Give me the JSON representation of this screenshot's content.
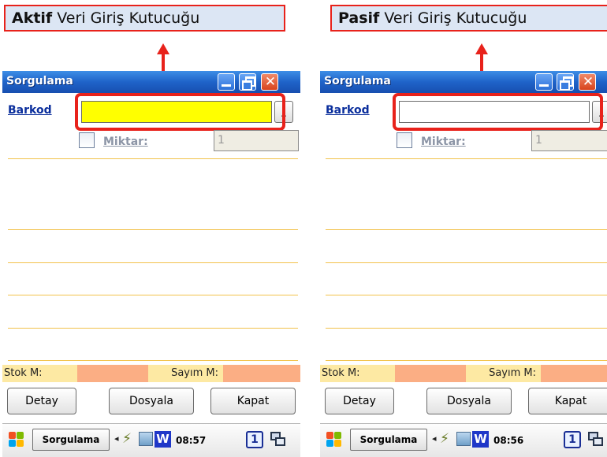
{
  "callouts": {
    "left_bold": "Aktif",
    "left_rest": " Veri Giriş Kutucuğu",
    "right_bold": "Pasif",
    "right_rest": " Veri Giriş Kutucuğu"
  },
  "colors": {
    "highlight": "#e8221b",
    "active_input_bg": "#ffff00",
    "passive_input_bg": "#ffffff",
    "row_line": "#f2c24b",
    "stok_label_bg": "#fde9a3",
    "stok_value_bg": "#fbae84",
    "titlebar": "#1f63c9"
  },
  "devices": [
    {
      "title": "Sorgulama",
      "barkod_label": "Barkod",
      "barkod_value": "",
      "browse_label": "..",
      "miktar_label": "Miktar:",
      "miktar_value": "1",
      "stok_label": "Stok M:",
      "sayim_label": "Sayım M:",
      "buttons": [
        "Detay",
        "Dosyala",
        "Kapat"
      ],
      "taskbar_title": "Sorgulama",
      "clock": "08:57",
      "page_number": "1"
    },
    {
      "title": "Sorgulama",
      "barkod_label": "Barkod",
      "barkod_value": "",
      "browse_label": "..",
      "miktar_label": "Miktar:",
      "miktar_value": "1",
      "stok_label": "Stok M:",
      "sayim_label": "Sayım M:",
      "buttons": [
        "Detay",
        "Dosyala",
        "Kapat"
      ],
      "taskbar_title": "Sorgulama",
      "clock": "08:56",
      "page_number": "1"
    }
  ]
}
